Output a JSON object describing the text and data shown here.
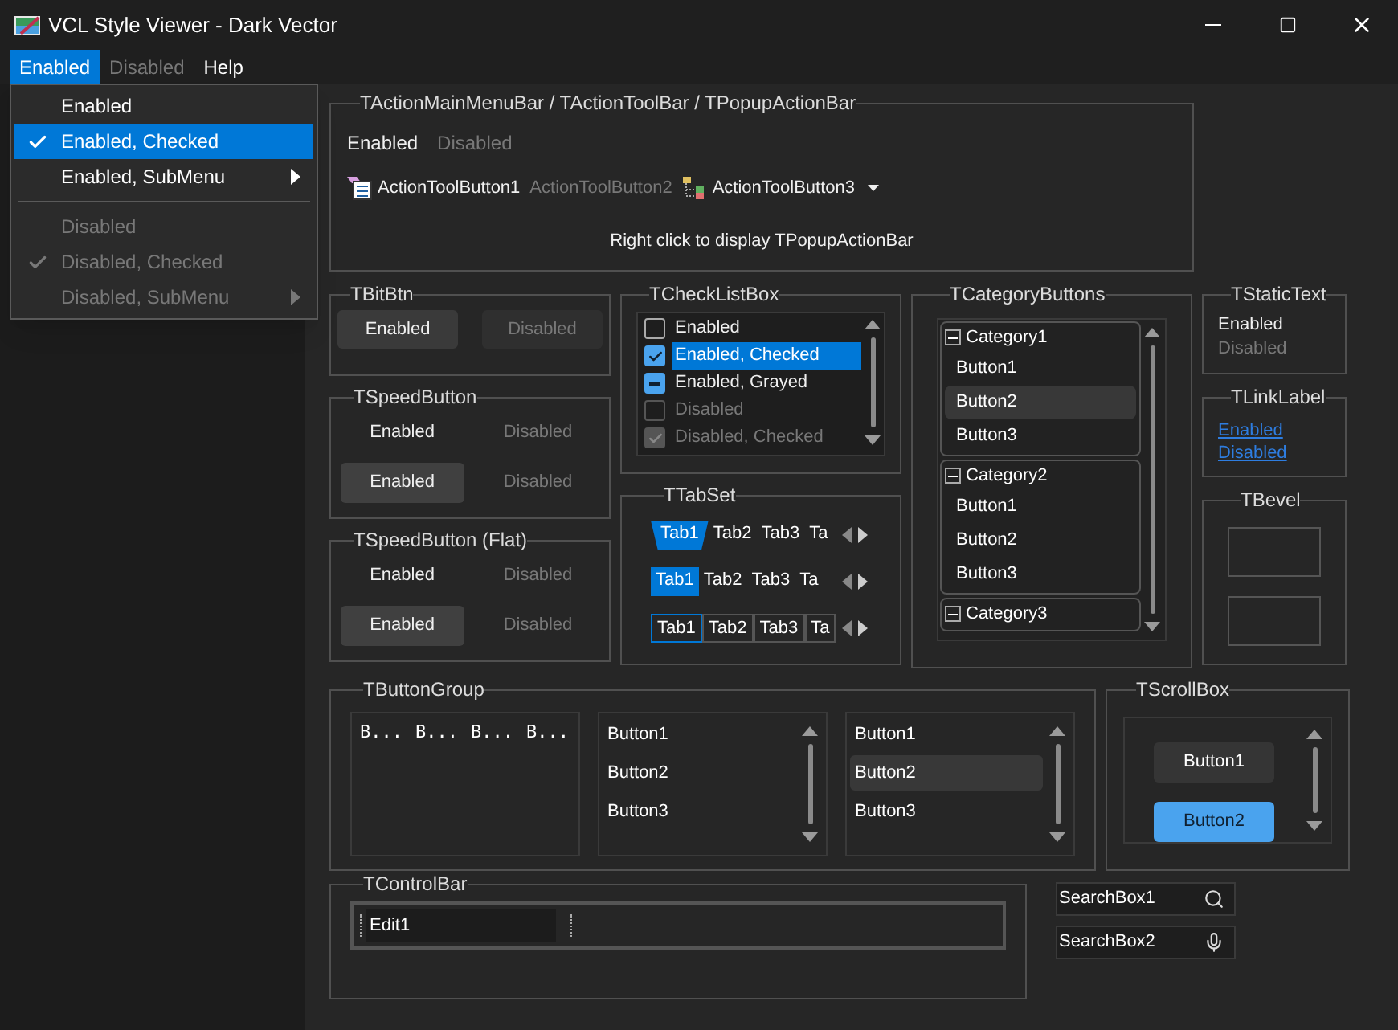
{
  "window": {
    "title": "VCL Style Viewer - Dark Vector"
  },
  "menu_bar": [
    {
      "label": "Enabled",
      "selected": true,
      "disabled": false
    },
    {
      "label": "Disabled",
      "selected": false,
      "disabled": true
    },
    {
      "label": "Help",
      "selected": false,
      "disabled": false
    }
  ],
  "popup_menu": {
    "items": [
      {
        "kind": "item",
        "label": "Enabled",
        "checked": false,
        "disabled": false,
        "submenu": false,
        "selected": false
      },
      {
        "kind": "item",
        "label": "Enabled, Checked",
        "checked": true,
        "disabled": false,
        "submenu": false,
        "selected": true
      },
      {
        "kind": "item",
        "label": "Enabled, SubMenu",
        "checked": false,
        "disabled": false,
        "submenu": true,
        "selected": false
      },
      {
        "kind": "separator"
      },
      {
        "kind": "item",
        "label": "Disabled",
        "checked": false,
        "disabled": true,
        "submenu": false,
        "selected": false
      },
      {
        "kind": "item",
        "label": "Disabled, Checked",
        "checked": true,
        "disabled": true,
        "submenu": false,
        "selected": false
      },
      {
        "kind": "item",
        "label": "Disabled, SubMenu",
        "checked": false,
        "disabled": true,
        "submenu": true,
        "selected": false
      }
    ]
  },
  "action_bar": {
    "title": "TActionMainMenuBar / TActionToolBar / TPopupActionBar",
    "menu_items": [
      {
        "label": "Enabled",
        "disabled": false
      },
      {
        "label": "Disabled",
        "disabled": true
      }
    ],
    "tool_buttons": [
      {
        "label": "ActionToolButton1",
        "kind": "list",
        "disabled": false,
        "dropdown": false
      },
      {
        "label": "ActionToolButton2",
        "kind": "plain",
        "disabled": true,
        "dropdown": false
      },
      {
        "label": "ActionToolButton3",
        "kind": "tree",
        "disabled": false,
        "dropdown": true
      }
    ],
    "hint": "Right click to display TPopupActionBar"
  },
  "bit_btn": {
    "title": "TBitBtn",
    "buttons": [
      {
        "label": "Enabled",
        "disabled": false
      },
      {
        "label": "Disabled",
        "disabled": true
      }
    ]
  },
  "speed_buttons": [
    {
      "title": "TSpeedButton",
      "buttons": [
        {
          "label": "Enabled",
          "disabled": false,
          "down": false
        },
        {
          "label": "Disabled",
          "disabled": true,
          "down": false
        },
        {
          "label": "Enabled",
          "disabled": false,
          "down": true
        },
        {
          "label": "Disabled",
          "disabled": true,
          "down": false
        }
      ]
    },
    {
      "title": "TSpeedButton (Flat)",
      "buttons": [
        {
          "label": "Enabled",
          "disabled": false,
          "down": false
        },
        {
          "label": "Disabled",
          "disabled": true,
          "down": false
        },
        {
          "label": "Enabled",
          "disabled": false,
          "down": true
        },
        {
          "label": "Disabled",
          "disabled": true,
          "down": false
        }
      ]
    }
  ],
  "check_list_box": {
    "title": "TCheckListBox",
    "items": [
      {
        "label": "Enabled",
        "checked": false,
        "grayed": false,
        "disabled": false,
        "selected": false
      },
      {
        "label": "Enabled, Checked",
        "checked": true,
        "grayed": false,
        "disabled": false,
        "selected": true
      },
      {
        "label": "Enabled, Grayed",
        "checked": false,
        "grayed": true,
        "disabled": false,
        "selected": false
      },
      {
        "label": "Disabled",
        "checked": false,
        "grayed": false,
        "disabled": true,
        "selected": false
      },
      {
        "label": "Disabled, Checked",
        "checked": true,
        "grayed": false,
        "disabled": true,
        "selected": false
      }
    ]
  },
  "tab_set": {
    "title": "TTabSet",
    "rows": [
      {
        "kind": "sloped",
        "tabs": [
          {
            "label": "Tab1",
            "selected": true
          },
          {
            "label": "Tab2",
            "selected": false
          },
          {
            "label": "Tab3",
            "selected": false
          },
          {
            "label": "Ta",
            "selected": false
          }
        ]
      },
      {
        "kind": "flat",
        "tabs": [
          {
            "label": "Tab1",
            "selected": true
          },
          {
            "label": "Tab2",
            "selected": false
          },
          {
            "label": "Tab3",
            "selected": false
          },
          {
            "label": "Ta",
            "selected": false
          }
        ]
      },
      {
        "kind": "boxed",
        "tabs": [
          {
            "label": "Tab1",
            "selected": true
          },
          {
            "label": "Tab2",
            "selected": false
          },
          {
            "label": "Tab3",
            "selected": false
          },
          {
            "label": "Ta",
            "selected": false
          }
        ]
      }
    ]
  },
  "category_buttons": {
    "title": "TCategoryButtons",
    "categories": [
      {
        "label": "Category1",
        "expanded": true,
        "buttons": [
          {
            "label": "Button1",
            "selected": false
          },
          {
            "label": "Button2",
            "selected": true
          },
          {
            "label": "Button3",
            "selected": false
          }
        ]
      },
      {
        "label": "Category2",
        "expanded": true,
        "buttons": [
          {
            "label": "Button1",
            "selected": false
          },
          {
            "label": "Button2",
            "selected": false
          },
          {
            "label": "Button3",
            "selected": false
          }
        ]
      },
      {
        "label": "Category3",
        "expanded": true
      }
    ]
  },
  "static_text": {
    "title": "TStaticText",
    "items": [
      {
        "label": "Enabled",
        "disabled": false
      },
      {
        "label": "Disabled",
        "disabled": true
      }
    ]
  },
  "link_label": {
    "title": "TLinkLabel",
    "links": [
      "Enabled",
      "Disabled"
    ]
  },
  "bevel": {
    "title": "TBevel"
  },
  "button_group": {
    "title": "TButtonGroup",
    "boxes": [
      {
        "kind": "compact",
        "buttons": [
          {
            "label": "B...",
            "selected": false
          },
          {
            "label": "B...",
            "selected": false
          },
          {
            "label": "B...",
            "selected": false
          },
          {
            "label": "B...",
            "selected": false
          }
        ]
      },
      {
        "kind": "list",
        "buttons": [
          {
            "label": "Button1",
            "selected": false
          },
          {
            "label": "Button2",
            "selected": false
          },
          {
            "label": "Button3",
            "selected": false
          }
        ]
      },
      {
        "kind": "list",
        "buttons": [
          {
            "label": "Button1",
            "selected": false
          },
          {
            "label": "Button2",
            "selected": true
          },
          {
            "label": "Button3",
            "selected": false
          }
        ]
      }
    ]
  },
  "scroll_box": {
    "title": "TScrollBox",
    "buttons": [
      {
        "label": "Button1",
        "focused": false
      },
      {
        "label": "Button2",
        "focused": true
      }
    ]
  },
  "control_bar": {
    "title": "TControlBar",
    "edit_value": "Edit1"
  },
  "search_boxes": [
    {
      "value": "SearchBox1",
      "kind": "search"
    },
    {
      "value": "SearchBox2",
      "kind": "mic"
    }
  ]
}
